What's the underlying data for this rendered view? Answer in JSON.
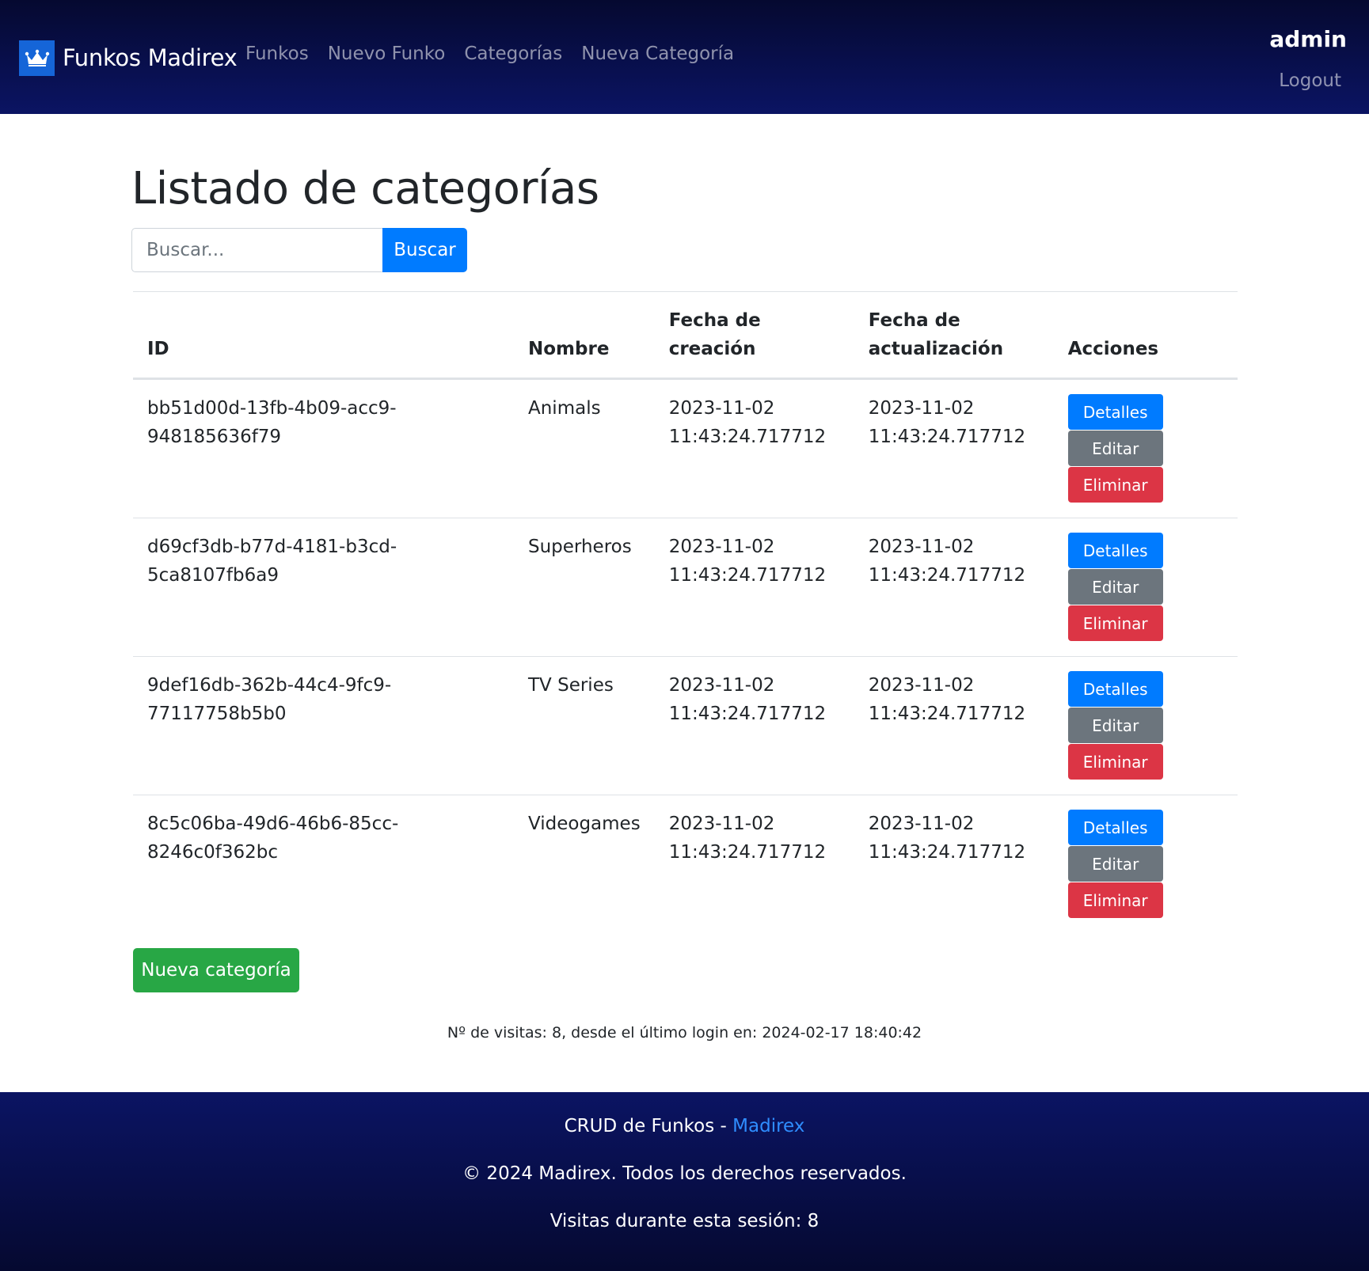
{
  "navbar": {
    "brand": "Funkos Madirex",
    "brand_icon": "crown-icon",
    "links": [
      "Funkos",
      "Nuevo Funko",
      "Categorías",
      "Nueva Categoría"
    ],
    "user": "admin",
    "logout": "Logout"
  },
  "main": {
    "title": "Listado de categorías",
    "search": {
      "placeholder": "Buscar...",
      "value": "",
      "button": "Buscar"
    },
    "table": {
      "headers": [
        "ID",
        "Nombre",
        "Fecha de creación",
        "Fecha de actualización",
        "Acciones"
      ],
      "rows": [
        {
          "id": "bb51d00d-13fb-4b09-acc9-948185636f79",
          "nombre": "Animals",
          "created_date": "2023-11-02",
          "created_time": "11:43:24.717712",
          "updated_date": "2023-11-02",
          "updated_time": "11:43:24.717712"
        },
        {
          "id": "d69cf3db-b77d-4181-b3cd-5ca8107fb6a9",
          "nombre": "Superheros",
          "created_date": "2023-11-02",
          "created_time": "11:43:24.717712",
          "updated_date": "2023-11-02",
          "updated_time": "11:43:24.717712"
        },
        {
          "id": "9def16db-362b-44c4-9fc9-77117758b5b0",
          "nombre": "TV Series",
          "created_date": "2023-11-02",
          "created_time": "11:43:24.717712",
          "updated_date": "2023-11-02",
          "updated_time": "11:43:24.717712"
        },
        {
          "id": "8c5c06ba-49d6-46b6-85cc-8246c0f362bc",
          "nombre": "Videogames",
          "created_date": "2023-11-02",
          "created_time": "11:43:24.717712",
          "updated_date": "2023-11-02",
          "updated_time": "11:43:24.717712"
        }
      ],
      "actions": {
        "details": "Detalles",
        "edit": "Editar",
        "delete": "Eliminar"
      }
    },
    "new_button": "Nueva categoría",
    "visits_note": "Nº de visitas: 8, desde el último login en: 2024-02-17 18:40:42"
  },
  "footer": {
    "line1_prefix": "CRUD de Funkos - ",
    "line1_link": "Madirex",
    "copyright": "© 2024 Madirex. Todos los derechos reservados.",
    "session_visits": "Visitas durante esta sesión: 8"
  },
  "colors": {
    "primary": "#007bff",
    "secondary": "#6c757d",
    "danger": "#dc3545",
    "success": "#28a745",
    "nav_dark": "#050930",
    "nav_blue": "#0b1463"
  }
}
